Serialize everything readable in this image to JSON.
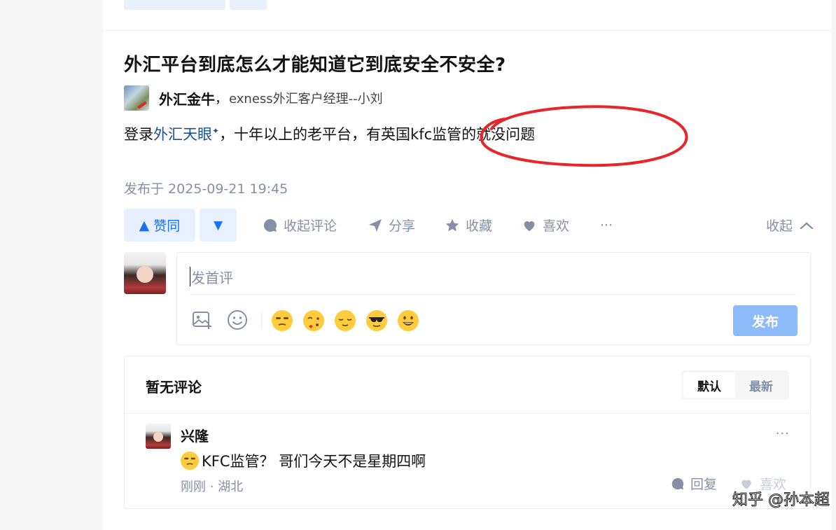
{
  "question": {
    "title": "外汇平台到底怎么才能知道它到底安全不安全?"
  },
  "author": {
    "name": "外汇金牛",
    "comma": "，",
    "headline": "exness外汇客户经理--小刘"
  },
  "answer": {
    "prefix": "登录",
    "link_text": "外汇天眼",
    "link_mark": "✦",
    "suffix": "，十年以上的老平台，有英国kfc监管的就没问题",
    "annotation_color": "#e8262a"
  },
  "publish_time": "发布于 2025-09-21 19:45",
  "actions": {
    "vote_up": "赞同",
    "collapse_comments": "收起评论",
    "share": "分享",
    "favorite": "收藏",
    "like": "喜欢",
    "more": "···",
    "collapse": "收起"
  },
  "editor": {
    "placeholder": "发首评",
    "publish": "发布"
  },
  "comments": {
    "empty_title": "暂无评论",
    "sort_default": "默认",
    "sort_latest": "最新",
    "items": [
      {
        "name": "兴隆",
        "text": "KFC监管？ 哥们今天不是星期四啊",
        "meta": "刚刚 · 湖北",
        "reply": "回复",
        "like": "喜欢",
        "more": "···"
      }
    ]
  },
  "watermark": "知乎 @孙本超",
  "colors": {
    "accent": "#1772f6",
    "accent_bg": "#e8f0ff",
    "muted": "#8590a6",
    "publish_disabled": "#8bbcf9"
  }
}
